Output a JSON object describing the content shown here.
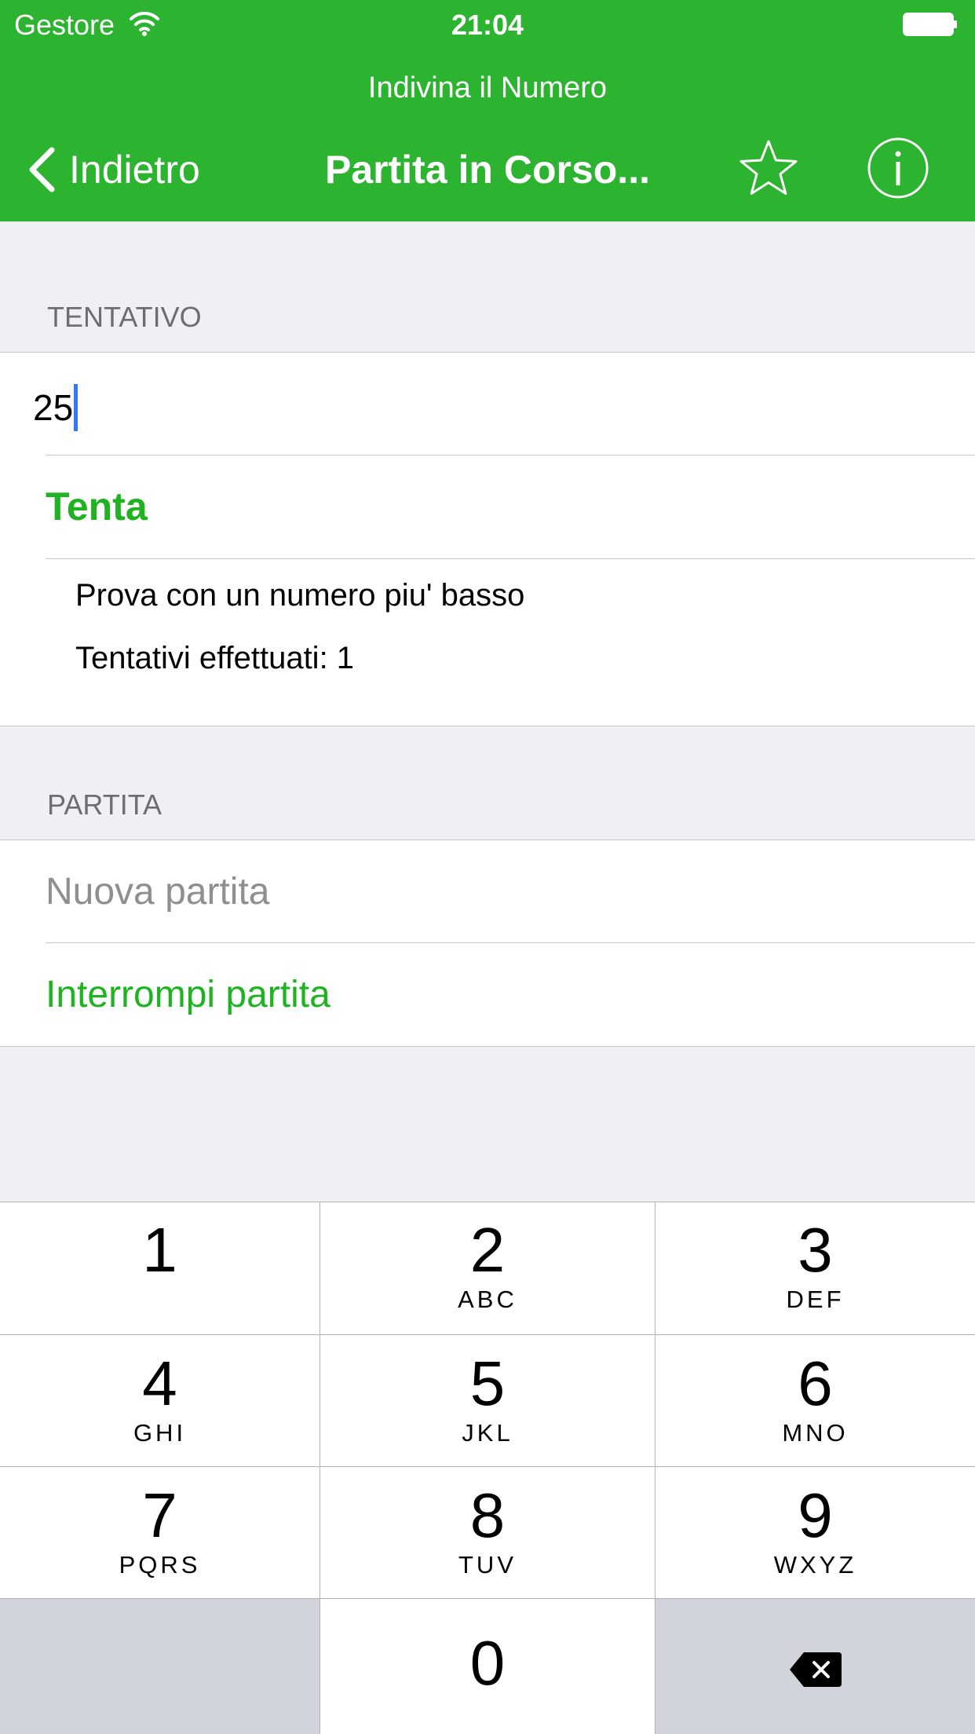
{
  "status": {
    "carrier": "Gestore",
    "time": "21:04"
  },
  "nav": {
    "app_title": "Indivina il Numero",
    "back_label": "Indietro",
    "title": "Partita in Corso...",
    "accent_color": "#2cb32f"
  },
  "sections": {
    "guess": {
      "header": "TENTATIVO",
      "input_value": "25",
      "submit_label": "Tenta",
      "hint": "Prova con un numero piu' basso",
      "attempts": "Tentativi effettuati: 1"
    },
    "game": {
      "header": "PARTITA",
      "new_game_label": "Nuova partita",
      "stop_game_label": "Interrompi partita"
    }
  },
  "keypad": {
    "keys": [
      {
        "num": "1",
        "letters": ""
      },
      {
        "num": "2",
        "letters": "ABC"
      },
      {
        "num": "3",
        "letters": "DEF"
      },
      {
        "num": "4",
        "letters": "GHI"
      },
      {
        "num": "5",
        "letters": "JKL"
      },
      {
        "num": "6",
        "letters": "MNO"
      },
      {
        "num": "7",
        "letters": "PQRS"
      },
      {
        "num": "8",
        "letters": "TUV"
      },
      {
        "num": "9",
        "letters": "WXYZ"
      },
      {
        "num": "0",
        "letters": ""
      }
    ],
    "delete_icon": "backspace-icon"
  }
}
